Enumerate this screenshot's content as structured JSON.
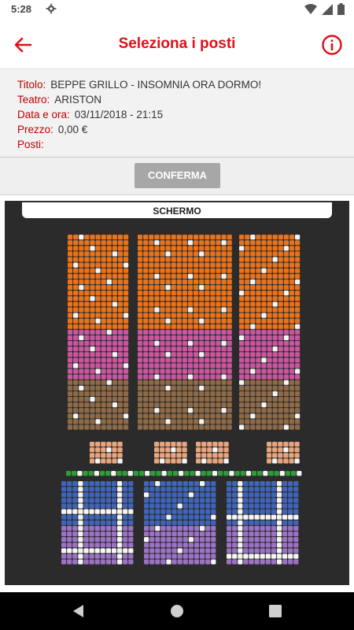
{
  "status": {
    "time": "5:28",
    "icons": [
      "gear-icon",
      "wifi-icon",
      "signal-icon",
      "battery-icon"
    ]
  },
  "app_bar": {
    "title": "Seleziona i posti",
    "back_icon": "arrow-left-icon",
    "info_icon": "info-icon"
  },
  "event": {
    "title_label": "Titolo:",
    "title_value": "BEPPE GRILLO - INSOMNIA ORA DORMO!",
    "theatre_label": "Teatro:",
    "theatre_value": "ARISTON",
    "date_label": "Data e ora:",
    "date_value": "03/11/2018 - 21:15",
    "price_label": "Prezzo:",
    "price_value": "0,00 €",
    "seats_label": "Posti:",
    "seats_value": ""
  },
  "confirm": {
    "label": "CONFERMA"
  },
  "map": {
    "screen_label": "SCHERMO"
  },
  "colors": {
    "accent": "#e0101a",
    "orange": "#e8731c",
    "pink": "#c9569f",
    "brown": "#8e6a47",
    "peach": "#e9a57d",
    "green": "#2f9c3a",
    "blue": "#3f64b8",
    "purple": "#9b72c4",
    "occupied": "#f5f5f5"
  },
  "nav": {
    "icons": [
      "back-triangle-icon",
      "home-circle-icon",
      "recents-square-icon"
    ]
  }
}
